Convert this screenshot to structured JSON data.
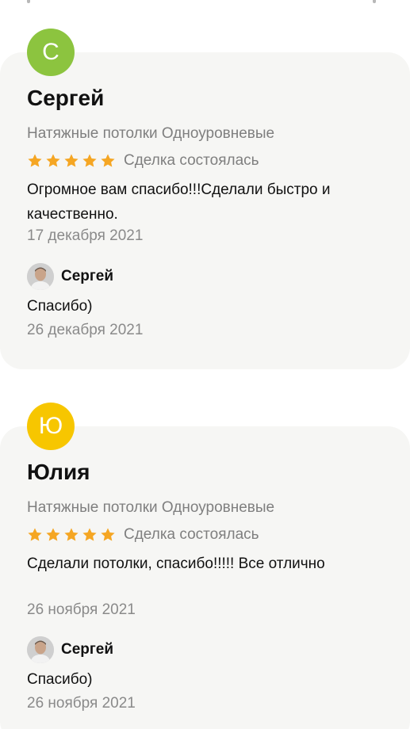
{
  "colors": {
    "card_bg": "#f6f6f4",
    "star": "#f5a623",
    "avatar_green": "#8cc43f",
    "avatar_yellow": "#f7c600",
    "muted_text": "#7f7f7f"
  },
  "reviews": [
    {
      "initial": "С",
      "avatar_color": "#8cc43f",
      "name": "Сергей",
      "category": "Натяжные потолки Одноуровневые",
      "stars": 5,
      "status": "Сделка состоялась",
      "text": "Огромное вам спасибо!!!Сделали быстро и качественно.",
      "date": "17 декабря 2021",
      "reply": {
        "author": "Сергей",
        "avatar_icon": "user-photo-icon",
        "text": "Спасибо)",
        "date": "26 декабря 2021"
      }
    },
    {
      "initial": "Ю",
      "avatar_color": "#f7c600",
      "name": "Юлия",
      "category": "Натяжные потолки Одноуровневые",
      "stars": 5,
      "status": "Сделка состоялась",
      "text": "Сделали потолки, спасибо!!!!! Все отлично",
      "date": "26 ноября 2021",
      "reply": {
        "author": "Сергей",
        "avatar_icon": "user-photo-icon",
        "text": "Спасибо)",
        "date": "26 ноября 2021"
      }
    }
  ]
}
